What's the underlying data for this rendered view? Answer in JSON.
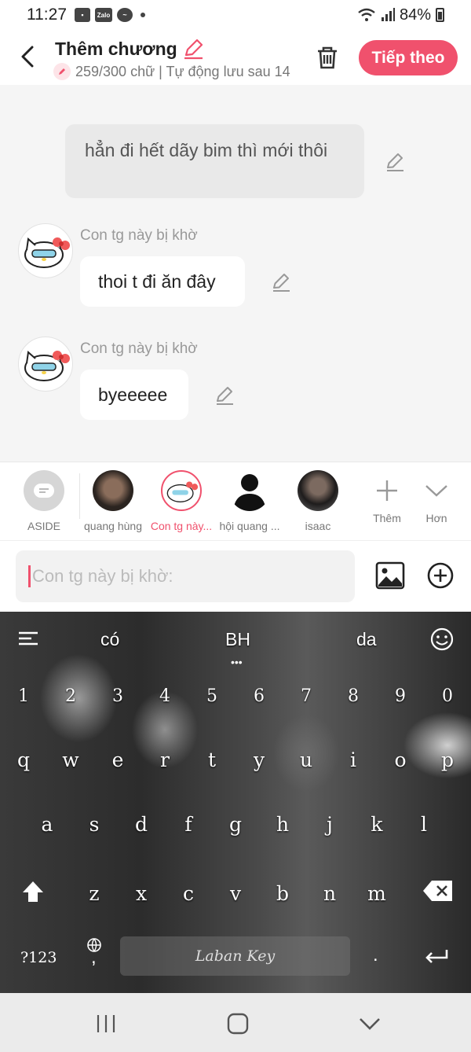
{
  "status": {
    "time": "11:27",
    "battery": "84%",
    "app_icons": [
      "gallery-icon",
      "zalo-icon",
      "messenger-icon"
    ],
    "zalo_label": "Zalo"
  },
  "header": {
    "title": "Thêm chương",
    "subtitle": "259/300 chữ | Tự động lưu sau 14",
    "next_label": "Tiếp theo"
  },
  "chat": {
    "narration": "hẳn đi hết dãy bim thì mới thôi",
    "messages": [
      {
        "speaker": "Con tg này bị khờ",
        "text": "thoi t đi ăn đây"
      },
      {
        "speaker": "Con tg này bị khờ",
        "text": "byeeeee"
      }
    ]
  },
  "characters": {
    "items": [
      {
        "label": "ASIDE"
      },
      {
        "label": "quang hùng"
      },
      {
        "label": "Con tg này..."
      },
      {
        "label": "hội quang ..."
      },
      {
        "label": "isaac"
      }
    ],
    "more_label": "Thêm",
    "less_label": "Hơn"
  },
  "input": {
    "placeholder": "Con tg này bị khờ:"
  },
  "keyboard": {
    "suggestions": [
      "có",
      "BH",
      "da"
    ],
    "numbers": [
      "1",
      "2",
      "3",
      "4",
      "5",
      "6",
      "7",
      "8",
      "9",
      "0"
    ],
    "row1": [
      "q",
      "w",
      "e",
      "r",
      "t",
      "y",
      "u",
      "i",
      "o",
      "p"
    ],
    "row2": [
      "a",
      "s",
      "d",
      "f",
      "g",
      "h",
      "j",
      "k",
      "l"
    ],
    "row3": [
      "z",
      "x",
      "c",
      "v",
      "b",
      "n",
      "m"
    ],
    "symbols_label": "?123",
    "comma": ",",
    "period": ".",
    "space_label": "Laban Key"
  },
  "colors": {
    "accent": "#f0516d",
    "background": "#f5f5f5"
  }
}
